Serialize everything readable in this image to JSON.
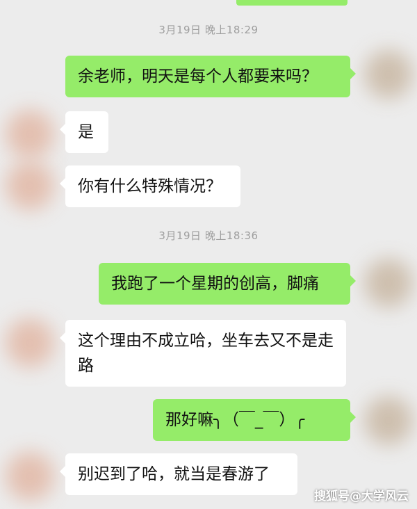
{
  "timestamps": [
    "3月19日 晚上18:29",
    "3月19日 晚上18:36"
  ],
  "messages": [
    {
      "side": "out",
      "text": "余老师，明天是每个人都要来吗？"
    },
    {
      "side": "in",
      "text": "是"
    },
    {
      "side": "in",
      "text": "你有什么特殊情况？"
    },
    {
      "side": "out",
      "text": "我跑了一个星期的创高，脚痛"
    },
    {
      "side": "in",
      "text": "这个理由不成立哈，坐车去又不是走路"
    },
    {
      "side": "out",
      "text": "那好嘛╮（￣_￣）╭"
    },
    {
      "side": "in",
      "text": "别迟到了哈，就当是春游了"
    }
  ],
  "watermark": "搜狐号@大学风云",
  "colors": {
    "incoming": "#ffffff",
    "outgoing": "#95ec69",
    "background": "#ececec"
  }
}
